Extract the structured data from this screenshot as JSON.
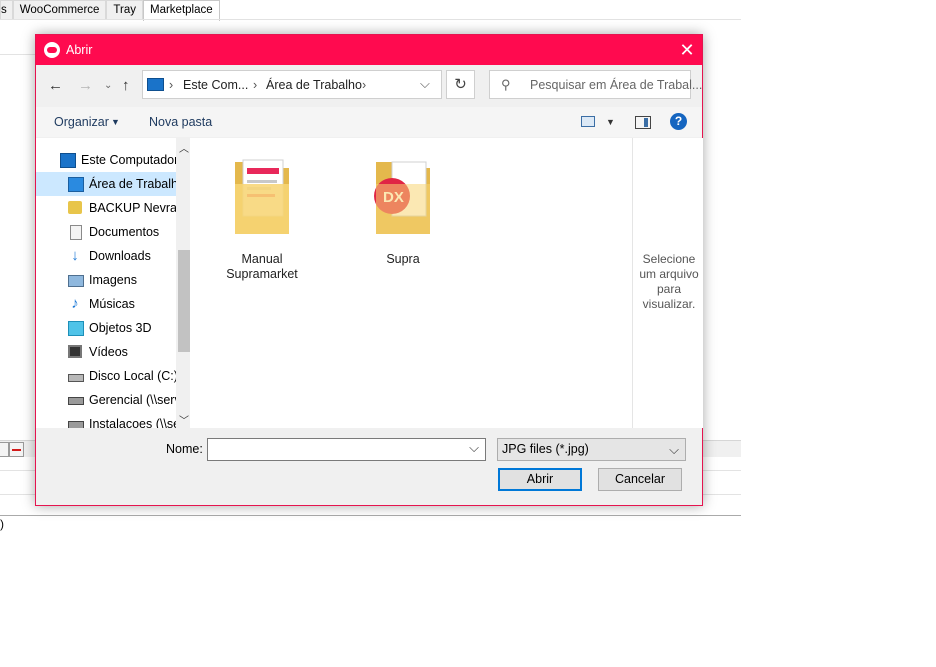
{
  "background_app": {
    "tabs": [
      {
        "label": "s"
      },
      {
        "label": "WooCommerce"
      },
      {
        "label": "Tray"
      },
      {
        "label": "Marketplace"
      }
    ],
    "stray_text": ")"
  },
  "dialog": {
    "title": "Abrir",
    "address": {
      "segments": [
        "Este Com...",
        "Área de Trabalho"
      ]
    },
    "search_placeholder": "Pesquisar em Área de Trabal...",
    "toolbar": {
      "organize_label": "Organizar",
      "new_folder_label": "Nova pasta"
    },
    "nav_items": [
      {
        "label": "Este Computador",
        "icon": "computer-icon"
      },
      {
        "label": "Área de Trabalho",
        "icon": "desktop-icon",
        "selected": true
      },
      {
        "label": "BACKUP Nevra",
        "icon": "user-folder-icon"
      },
      {
        "label": "Documentos",
        "icon": "documents-icon"
      },
      {
        "label": "Downloads",
        "icon": "downloads-icon"
      },
      {
        "label": "Imagens",
        "icon": "pictures-icon"
      },
      {
        "label": "Músicas",
        "icon": "music-icon"
      },
      {
        "label": "Objetos 3D",
        "icon": "3d-objects-icon"
      },
      {
        "label": "Vídeos",
        "icon": "videos-icon"
      },
      {
        "label": "Disco Local (C:)",
        "icon": "local-disk-icon"
      },
      {
        "label": "Gerencial (\\\\serv",
        "icon": "network-drive-icon"
      },
      {
        "label": "Instalacoes (\\\\se",
        "icon": "network-drive-icon"
      }
    ],
    "files": [
      {
        "name": "Manual Supramarket",
        "icon": "folder-icon"
      },
      {
        "name": "Supra",
        "icon": "folder-icon"
      }
    ],
    "preview_text": "Selecione um arquivo para visualizar.",
    "filename_label": "Nome:",
    "filename_value": "",
    "filetype_selected": "JPG files (*.jpg)",
    "open_label": "Abrir",
    "cancel_label": "Cancelar",
    "colors": {
      "accent": "#ff0a4f",
      "selection": "#cce8ff",
      "primary_border": "#0078d7"
    }
  }
}
